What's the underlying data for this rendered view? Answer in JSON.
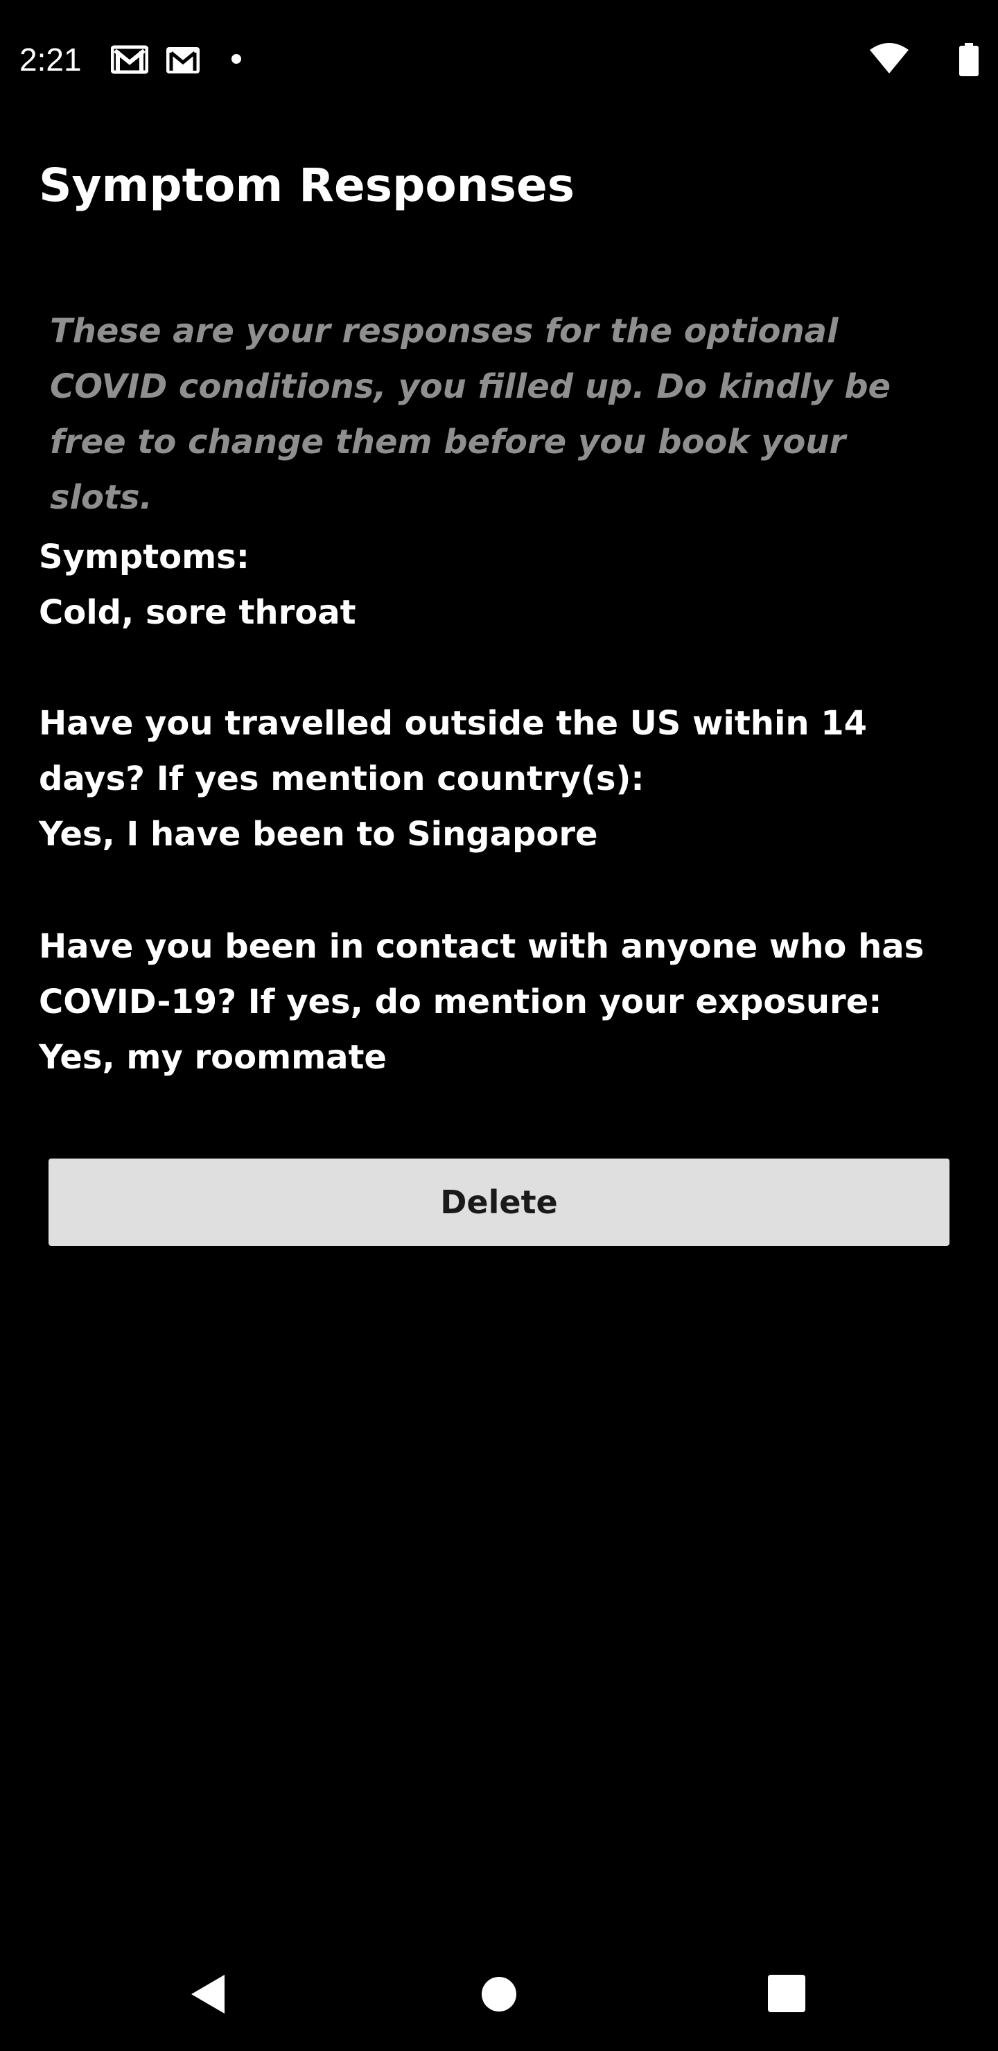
{
  "status_bar": {
    "time": "2:21",
    "icons": [
      "gmail-icon",
      "gmail-icon",
      "notification-dot-icon",
      "wifi-icon",
      "battery-icon"
    ]
  },
  "page": {
    "title": "Symptom Responses",
    "intro": "These are your responses for the optional COVID conditions, you filled up. Do kindly be free to change them before you book your slots."
  },
  "responses": [
    {
      "question": "Symptoms:",
      "answer": "Cold, sore throat"
    },
    {
      "question": "Have you travelled outside the US within 14 days? If yes mention country(s):",
      "answer": "Yes, I have been to Singapore"
    },
    {
      "question": "Have you been in contact with anyone who has COVID-19? If yes, do mention your exposure:",
      "answer": "Yes, my roommate"
    }
  ],
  "actions": {
    "delete_label": "Delete"
  },
  "nav_bar": {
    "icons": [
      "back-icon",
      "home-icon",
      "recents-icon"
    ]
  },
  "colors": {
    "background": "#000000",
    "text": "#ffffff",
    "intro_text": "#8f8f8f",
    "button_bg": "#dfdfdf",
    "button_text": "#1a1a1a"
  }
}
